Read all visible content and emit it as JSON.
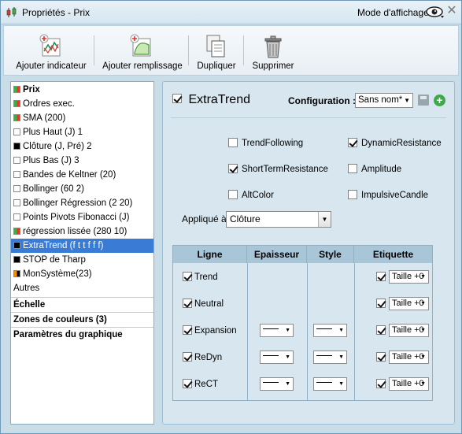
{
  "window": {
    "title": "Propriétés - Prix",
    "mode_label": "Mode d'affichage",
    "icons": {
      "app": "candlestick-icon",
      "eye": "eye-icon",
      "close": "close-icon"
    }
  },
  "toolbar": {
    "buttons": [
      {
        "label": "Ajouter indicateur",
        "icon": "add-indicator-icon"
      },
      {
        "label": "Ajouter remplissage",
        "icon": "add-fill-icon"
      },
      {
        "label": "Dupliquer",
        "icon": "duplicate-icon"
      },
      {
        "label": "Supprimer",
        "icon": "trash-icon"
      }
    ]
  },
  "sidebar": {
    "items": [
      {
        "label": "Prix",
        "swatch": [
          "#3cb043",
          "#e03a2f"
        ],
        "bold": true,
        "selected": false
      },
      {
        "label": "Ordres exec.",
        "swatch": [
          "#3cb043",
          "#e03a2f"
        ],
        "bold": false,
        "selected": false
      },
      {
        "label": "SMA (200)",
        "swatch": [
          "#3cb043",
          "#e03a2f"
        ],
        "bold": false,
        "selected": false
      },
      {
        "label": "Plus Haut (J) 1",
        "swatch": [
          "#ffffff",
          "#ffffff"
        ],
        "bold": false,
        "selected": false
      },
      {
        "label": "Clôture (J, Pré) 2",
        "swatch": [
          "#000000",
          "#000000"
        ],
        "bold": false,
        "selected": false
      },
      {
        "label": "Plus Bas (J) 3",
        "swatch": [
          "#ffffff",
          "#ffffff"
        ],
        "bold": false,
        "selected": false
      },
      {
        "label": "Bandes de Keltner (20)",
        "swatch": [
          "#ffffff",
          "#ffffff"
        ],
        "bold": false,
        "selected": false
      },
      {
        "label": "Bollinger (60 2)",
        "swatch": [
          "#ffffff",
          "#ffffff"
        ],
        "bold": false,
        "selected": false
      },
      {
        "label": "Bollinger Régression (2 20)",
        "swatch": [
          "#ffffff",
          "#ffffff"
        ],
        "bold": false,
        "selected": false
      },
      {
        "label": "Points Pivots Fibonacci (J)",
        "swatch": [
          "#ffffff",
          "#ffffff"
        ],
        "bold": false,
        "selected": false
      },
      {
        "label": "régression lissée (280 10)",
        "swatch": [
          "#3cb043",
          "#e03a2f"
        ],
        "bold": false,
        "selected": false
      },
      {
        "label": "ExtraTrend (f t t f f f)",
        "swatch": [
          "#000000",
          "#000000"
        ],
        "bold": false,
        "selected": true
      },
      {
        "label": "STOP de Tharp",
        "swatch": [
          "#000000",
          "#000000"
        ],
        "bold": false,
        "selected": false
      },
      {
        "label": "MonSystème(23)",
        "swatch": [
          "#ff8c00",
          "#000000"
        ],
        "bold": false,
        "selected": false
      },
      {
        "label": "Autres",
        "swatch": null,
        "bold": false,
        "selected": false
      }
    ],
    "sections": [
      "Échelle",
      "Zones de couleurs (3)",
      "Paramètres du graphique"
    ]
  },
  "panel": {
    "title": "ExtraTrend",
    "title_checked": true,
    "config_label": "Configuration :",
    "config_value": "Sans nom*",
    "options": [
      {
        "label": "TrendFollowing",
        "checked": false
      },
      {
        "label": "DynamicResistance",
        "checked": true
      },
      {
        "label": "ShortTermResistance",
        "checked": true
      },
      {
        "label": "Amplitude",
        "checked": false
      },
      {
        "label": "AltColor",
        "checked": false
      },
      {
        "label": "ImpulsiveCandle",
        "checked": false
      }
    ],
    "applied_label": "Appliqué à",
    "applied_value": "Clôture",
    "table": {
      "headers": [
        "Ligne",
        "Epaisseur",
        "Style",
        "Etiquette"
      ],
      "rows": [
        {
          "name": "Trend",
          "checked": true,
          "has_line_selects": false,
          "label_checked": true,
          "label_value": "Taille +0"
        },
        {
          "name": "Neutral",
          "checked": true,
          "has_line_selects": false,
          "label_checked": true,
          "label_value": "Taille +0"
        },
        {
          "name": "Expansion",
          "checked": true,
          "has_line_selects": true,
          "label_checked": true,
          "label_value": "Taille +0"
        },
        {
          "name": "ReDyn",
          "checked": true,
          "has_line_selects": true,
          "label_checked": true,
          "label_value": "Taille +0"
        },
        {
          "name": "ReCT",
          "checked": true,
          "has_line_selects": true,
          "label_checked": true,
          "label_value": "Taille +0"
        }
      ]
    }
  }
}
